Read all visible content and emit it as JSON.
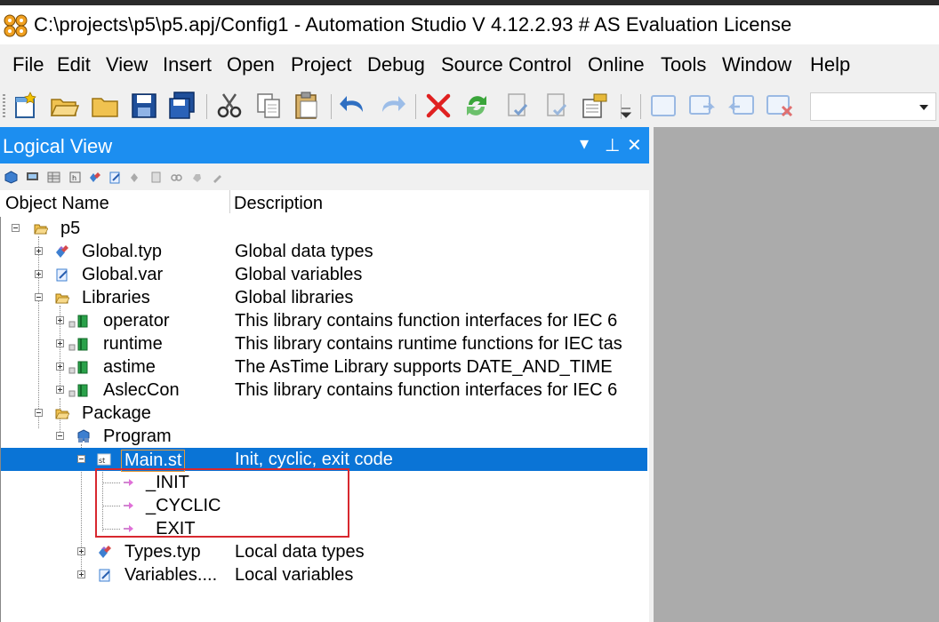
{
  "window": {
    "title": "C:\\projects\\p5\\p5.apj/Config1 - Automation Studio V 4.12.2.93 # AS Evaluation License"
  },
  "menu": [
    "File",
    "Edit",
    "View",
    "Insert",
    "Open",
    "Project",
    "Debug",
    "Source Control",
    "Online",
    "Tools",
    "Window",
    "Help"
  ],
  "toolbar": {
    "buttons": [
      "new-project-icon",
      "open-folder-icon",
      "folder-icon",
      "save-icon",
      "save-all-icon",
      "cut-icon",
      "copy-icon",
      "paste-icon",
      "undo-icon",
      "redo-icon",
      "delete-icon",
      "refresh-icon",
      "check-in-icon",
      "check-out-icon",
      "build-icon",
      "window-icon",
      "window-forward-icon",
      "window-back-icon",
      "window-close-icon"
    ],
    "combo_value": ""
  },
  "panel": {
    "title": "Logical View",
    "controls": [
      "▾",
      "⊥",
      "✕"
    ]
  },
  "columns": {
    "name": "Object Name",
    "description": "Description"
  },
  "tree": [
    {
      "name": "p5",
      "desc": "",
      "icon": "folder-open-icon"
    },
    {
      "name": "Global.typ",
      "desc": "Global data types",
      "icon": "datatype-icon"
    },
    {
      "name": "Global.var",
      "desc": "Global variables",
      "icon": "variable-icon"
    },
    {
      "name": "Libraries",
      "desc": "Global libraries",
      "icon": "folder-open-icon"
    },
    {
      "name": "operator",
      "desc": "This library contains function interfaces for IEC 6",
      "icon": "library-icon"
    },
    {
      "name": "runtime",
      "desc": "This library contains runtime functions for IEC tas",
      "icon": "library-icon"
    },
    {
      "name": "astime",
      "desc": "The AsTime Library supports DATE_AND_TIME",
      "icon": "library-icon"
    },
    {
      "name": "AslecCon",
      "desc": "This library contains function interfaces for IEC 6",
      "icon": "library-icon"
    },
    {
      "name": "Package",
      "desc": "",
      "icon": "folder-open-icon"
    },
    {
      "name": "Program",
      "desc": "",
      "icon": "program-icon"
    },
    {
      "name": "Main.st",
      "desc": "Init, cyclic, exit code",
      "icon": "st-file-icon"
    },
    {
      "name": "_INIT",
      "desc": "",
      "icon": "action-arrow-icon"
    },
    {
      "name": "_CYCLIC",
      "desc": "",
      "icon": "action-arrow-icon"
    },
    {
      "name": "_EXIT",
      "desc": "",
      "icon": "action-arrow-icon"
    },
    {
      "name": "Types.typ",
      "desc": "Local data types",
      "icon": "datatype-icon"
    },
    {
      "name": "Variables....",
      "desc": "Local variables",
      "icon": "variable-icon"
    }
  ],
  "colors": {
    "panel_header": "#1c8ef0",
    "selection": "#0a74d6",
    "callout": "#d8282f",
    "workspace": "#ababab"
  }
}
